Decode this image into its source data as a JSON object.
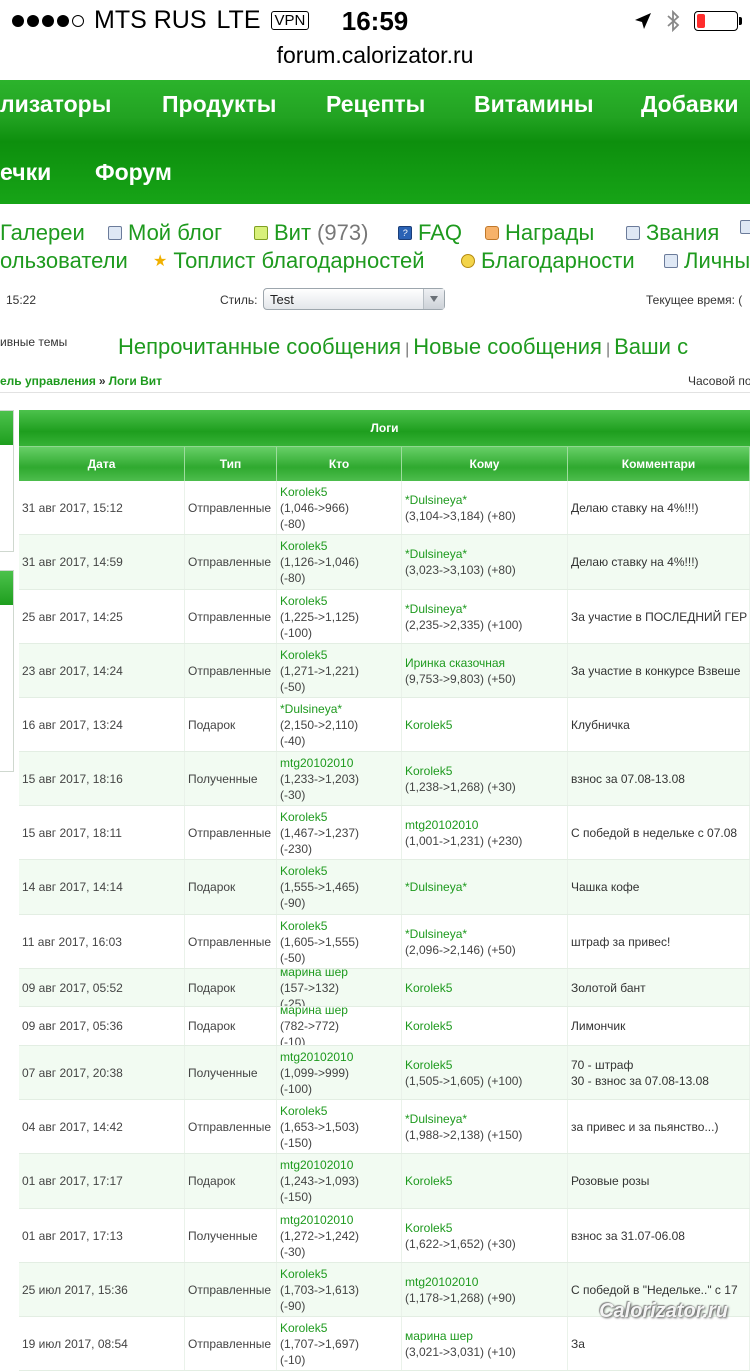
{
  "status_bar": {
    "carrier": "MTS RUS",
    "network": "LTE",
    "vpn": "VPN",
    "time": "16:59",
    "signal_bars": 4,
    "battery_color": "#ff2d2d"
  },
  "browser": {
    "url": "forum.calorizator.ru"
  },
  "nav": {
    "row1": [
      "лизаторы",
      "Продукты",
      "Рецепты",
      "Витамины",
      "Добавки"
    ],
    "row2": [
      "ечки",
      "Форум"
    ]
  },
  "links": {
    "row1": [
      {
        "label": "Галереи",
        "icon": "gallery-icon"
      },
      {
        "label": "Мой блог",
        "icon": "blog-icon"
      },
      {
        "label": "Вит",
        "count": "(973)",
        "icon": "vit-icon"
      },
      {
        "label": "FAQ",
        "icon": "faq-icon"
      },
      {
        "label": "Награды",
        "icon": "awards-icon"
      },
      {
        "label": "Звания",
        "icon": "ranks-icon"
      }
    ],
    "row2": [
      {
        "label": "ользователи",
        "icon": ""
      },
      {
        "label": "Топлист благодарностей",
        "icon": "star-icon"
      },
      {
        "label": "Благодарности",
        "icon": "thanks-icon"
      },
      {
        "label": "Личны",
        "icon": "personal-icon"
      }
    ]
  },
  "info": {
    "last_visit": "15:22",
    "style_label": "Стиль:",
    "style_value": "Test",
    "current_time_label": "Текущее время: (",
    "active_topics": "ивные темы",
    "timezone": "Часовой по"
  },
  "quick_links": [
    "Непрочитанные сообщения",
    "Новые сообщения",
    "Ваши с"
  ],
  "breadcrumb": [
    "ель управления",
    "Логи Вит"
  ],
  "table": {
    "title": "Логи",
    "headers": [
      "Дата",
      "Тип",
      "Кто",
      "Кому",
      "Комментари"
    ],
    "rows": [
      {
        "date": "31 авг 2017, 15:12",
        "type": "Отправленные",
        "from": "Korolek5",
        "from_delta": "(1,046->966) (-80)",
        "to": "*Dulsineya*",
        "to_delta": "(3,104->3,184) (+80)",
        "comment": "Делаю ставку на 4%!!!)"
      },
      {
        "date": "31 авг 2017, 14:59",
        "type": "Отправленные",
        "from": "Korolek5",
        "from_delta": "(1,126->1,046) (-80)",
        "to": "*Dulsineya*",
        "to_delta": "(3,023->3,103) (+80)",
        "comment": "Делаю ставку на 4%!!!)"
      },
      {
        "date": "25 авг 2017, 14:25",
        "type": "Отправленные",
        "from": "Korolek5",
        "from_delta": "(1,225->1,125) (-100)",
        "to": "*Dulsineya*",
        "to_delta": "(2,235->2,335) (+100)",
        "comment": "За участие в ПОСЛЕДНИЙ ГЕР"
      },
      {
        "date": "23 авг 2017, 14:24",
        "type": "Отправленные",
        "from": "Korolek5",
        "from_delta": "(1,271->1,221) (-50)",
        "to": "Иринка сказочная",
        "to_delta": "(9,753->9,803) (+50)",
        "comment": "За участие в конкурсе Взвеше"
      },
      {
        "date": "16 авг 2017, 13:24",
        "type": "Подарок",
        "from": "*Dulsineya*",
        "from_delta": "(2,150->2,110) (-40)",
        "to": "Korolek5",
        "to_delta": "",
        "comment": "Клубничка"
      },
      {
        "date": "15 авг 2017, 18:16",
        "type": "Полученные",
        "from": "mtg20102010",
        "from_delta": "(1,233->1,203) (-30)",
        "to": "Korolek5",
        "to_delta": "(1,238->1,268) (+30)",
        "comment": "взнос за 07.08-13.08"
      },
      {
        "date": "15 авг 2017, 18:11",
        "type": "Отправленные",
        "from": "Korolek5",
        "from_delta": "(1,467->1,237) (-230)",
        "to": "mtg20102010",
        "to_delta": "(1,001->1,231) (+230)",
        "comment": "С победой в недельке с 07.08"
      },
      {
        "date": "14 авг 2017, 14:14",
        "type": "Подарок",
        "from": "Korolek5",
        "from_delta": "(1,555->1,465) (-90)",
        "to": "*Dulsineya*",
        "to_delta": "",
        "comment": "Чашка кофе"
      },
      {
        "date": "11 авг 2017, 16:03",
        "type": "Отправленные",
        "from": "Korolek5",
        "from_delta": "(1,605->1,555) (-50)",
        "to": "*Dulsineya*",
        "to_delta": "(2,096->2,146) (+50)",
        "comment": "штраф за привес!"
      },
      {
        "date": "09 авг 2017, 05:52",
        "type": "Подарок",
        "from": "марина шер",
        "from_delta": "(157->132) (-25)",
        "to": "Korolek5",
        "to_delta": "",
        "comment": "Золотой бант"
      },
      {
        "date": "09 авг 2017, 05:36",
        "type": "Подарок",
        "from": "марина шер",
        "from_delta": "(782->772) (-10)",
        "to": "Korolek5",
        "to_delta": "",
        "comment": "Лимончик"
      },
      {
        "date": "07 авг 2017, 20:38",
        "type": "Полученные",
        "from": "mtg20102010",
        "from_delta": "(1,099->999) (-100)",
        "to": "Korolek5",
        "to_delta": "(1,505->1,605) (+100)",
        "comment": "70 - штраф\n30 - взнос за 07.08-13.08"
      },
      {
        "date": "04 авг 2017, 14:42",
        "type": "Отправленные",
        "from": "Korolek5",
        "from_delta": "(1,653->1,503) (-150)",
        "to": "*Dulsineya*",
        "to_delta": "(1,988->2,138) (+150)",
        "comment": "за привес и за пьянство...)"
      },
      {
        "date": "01 авг 2017, 17:17",
        "type": "Подарок",
        "from": "mtg20102010",
        "from_delta": "(1,243->1,093) (-150)",
        "to": "Korolek5",
        "to_delta": "",
        "comment": "Розовые розы"
      },
      {
        "date": "01 авг 2017, 17:13",
        "type": "Полученные",
        "from": "mtg20102010",
        "from_delta": "(1,272->1,242) (-30)",
        "to": "Korolek5",
        "to_delta": "(1,622->1,652) (+30)",
        "comment": "взнос за 31.07-06.08"
      },
      {
        "date": "25 июл 2017, 15:36",
        "type": "Отправленные",
        "from": "Korolek5",
        "from_delta": "(1,703->1,613) (-90)",
        "to": "mtg20102010",
        "to_delta": "(1,178->1,268) (+90)",
        "comment": "С победой в \"Недельке..\" с 17"
      },
      {
        "date": "19 июл 2017, 08:54",
        "type": "Отправленные",
        "from": "Korolek5",
        "from_delta": "(1,707->1,697) (-10)",
        "to": "марина шер",
        "to_delta": "(3,021->3,031) (+10)",
        "comment": "За"
      }
    ]
  },
  "watermark": "Calorizator.ru",
  "colors": {
    "brand_green": "#1e9a1e",
    "nav_green": "#17a417"
  }
}
